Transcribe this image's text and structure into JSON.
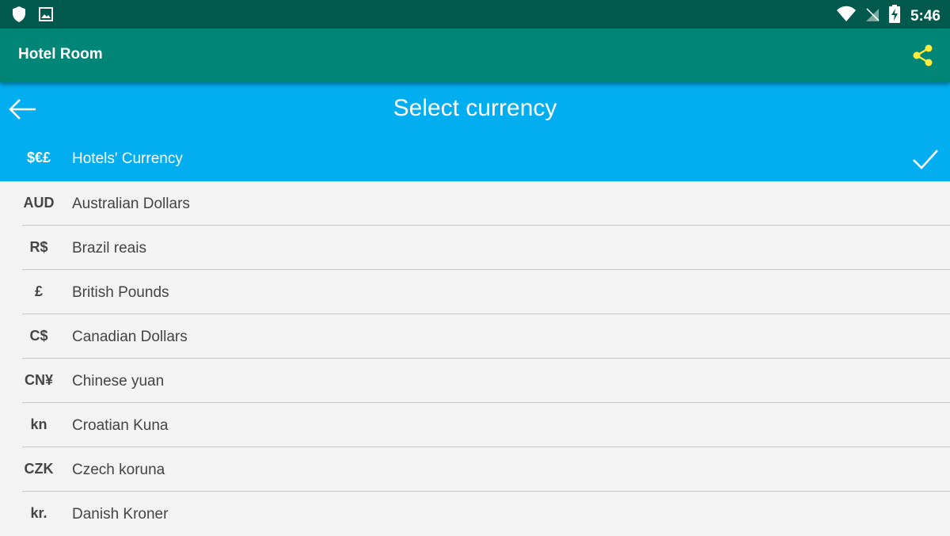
{
  "status_bar": {
    "time": "5:46",
    "icons": [
      "shield-icon",
      "image-icon",
      "wifi-icon",
      "signal-off-icon",
      "battery-charging-icon"
    ]
  },
  "app_bar": {
    "title": "Hotel Room",
    "share_icon": "share-icon",
    "share_color": "#ffeb3b"
  },
  "header": {
    "title": "Select currency",
    "back_icon": "arrow-left-icon"
  },
  "colors": {
    "status_bar": "#00594c",
    "app_bar": "#008577",
    "header": "#03aef0",
    "list_bg": "#f3f3f3",
    "text": "#444444"
  },
  "currencies": [
    {
      "symbol": "$€£",
      "name": "Hotels' Currency",
      "selected": true
    },
    {
      "symbol": "AUD",
      "name": "Australian Dollars",
      "selected": false
    },
    {
      "symbol": "R$",
      "name": "Brazil reais",
      "selected": false
    },
    {
      "symbol": "£",
      "name": "British Pounds",
      "selected": false
    },
    {
      "symbol": "C$",
      "name": "Canadian Dollars",
      "selected": false
    },
    {
      "symbol": "CN¥",
      "name": "Chinese yuan",
      "selected": false
    },
    {
      "symbol": "kn",
      "name": "Croatian Kuna",
      "selected": false
    },
    {
      "symbol": "CZK",
      "name": "Czech koruna",
      "selected": false
    },
    {
      "symbol": "kr.",
      "name": "Danish Kroner",
      "selected": false
    }
  ]
}
